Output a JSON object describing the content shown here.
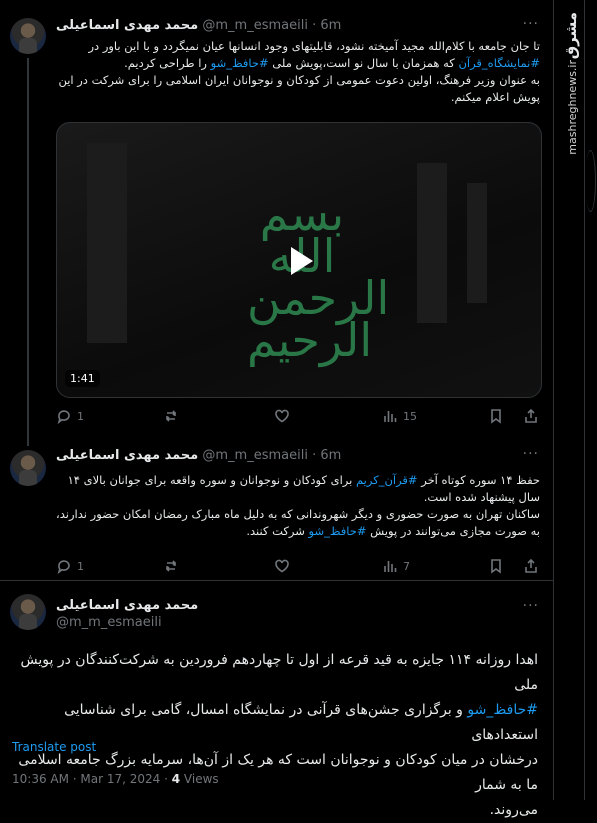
{
  "sidebar": {
    "logo": "مشرق",
    "url": "mashreghnews.ir"
  },
  "tweet1": {
    "name": "محمد مهدی اسماعیلی",
    "handle": "@m_m_esmaeili",
    "time": "· 6m",
    "lines": [
      [
        "تا جان جامعه با کلام‌الله مجید آمیخته نشود، قابلیتهای وجود انسانها عیان نمیگردد و با این باور در",
        null
      ],
      [
        "",
        "#نمایشگاه_قرآن",
        " که همزمان با سال نو است،پویش ملی ",
        "#حافظ_شو",
        " را طراحی کردیم."
      ],
      [
        "به عنوان وزیر فرهنگ، اولین دعوت عمومی از کودکان و نوجوانان ایران اسلامی را برای شرکت در این",
        null
      ],
      [
        "پویش اعلام میکنم.",
        null
      ]
    ],
    "media": {
      "duration": "1:41",
      "calligraphy": "بسم الله الرحمن الرحیم"
    },
    "actions": {
      "replies": "1",
      "views": "15"
    }
  },
  "tweet2": {
    "name": "محمد مهدی اسماعیلی",
    "handle": "@m_m_esmaeili",
    "time": "· 6m",
    "l1a": "حفظ ۱۴ سوره کوتاه آخر ",
    "l1tag": "#قرآن_کریم",
    "l1b": " برای کودکان و نوجوانان و سوره واقعه برای جوانان بالای ۱۴",
    "l2": "سال پیشنهاد شده است.",
    "l3": "ساکنان تهران به صورت حضوری و دیگر شهروندانی که به دلیل ماه مبارک رمضان امکان حضور ندارند،",
    "l4a": "به صورت مجازی می‌توانند در پویش ",
    "l4tag": "#حافظ_شو",
    "l4b": " شرکت کنند.",
    "actions": {
      "replies": "1",
      "views": "7"
    }
  },
  "tweet3": {
    "name": "محمد مهدی اسماعیلی",
    "handle": "@m_m_esmaeili",
    "l1": "اهدا روزانه ۱۱۴ جایزه به قید قرعه از اول تا چهاردهم فروردین به شرکت‌کنندگان در پویش ملی",
    "l2tag": "#حافظ_شو",
    "l2": " و برگزاری جشن‌های قرآنی در نمایشگاه امسال، گامی برای شناسایی استعدادهای",
    "l3": "درخشان در میان کودکان و نوجوانان است که هر یک از آن‌ها، سرمایه بزرگ جامعه اسلامی ما به شمار",
    "l4": "می‌روند.",
    "translate": "Translate post",
    "time": "10:36 AM · Mar 17, 2024 · ",
    "views_count": "4",
    "views_label": " Views"
  }
}
